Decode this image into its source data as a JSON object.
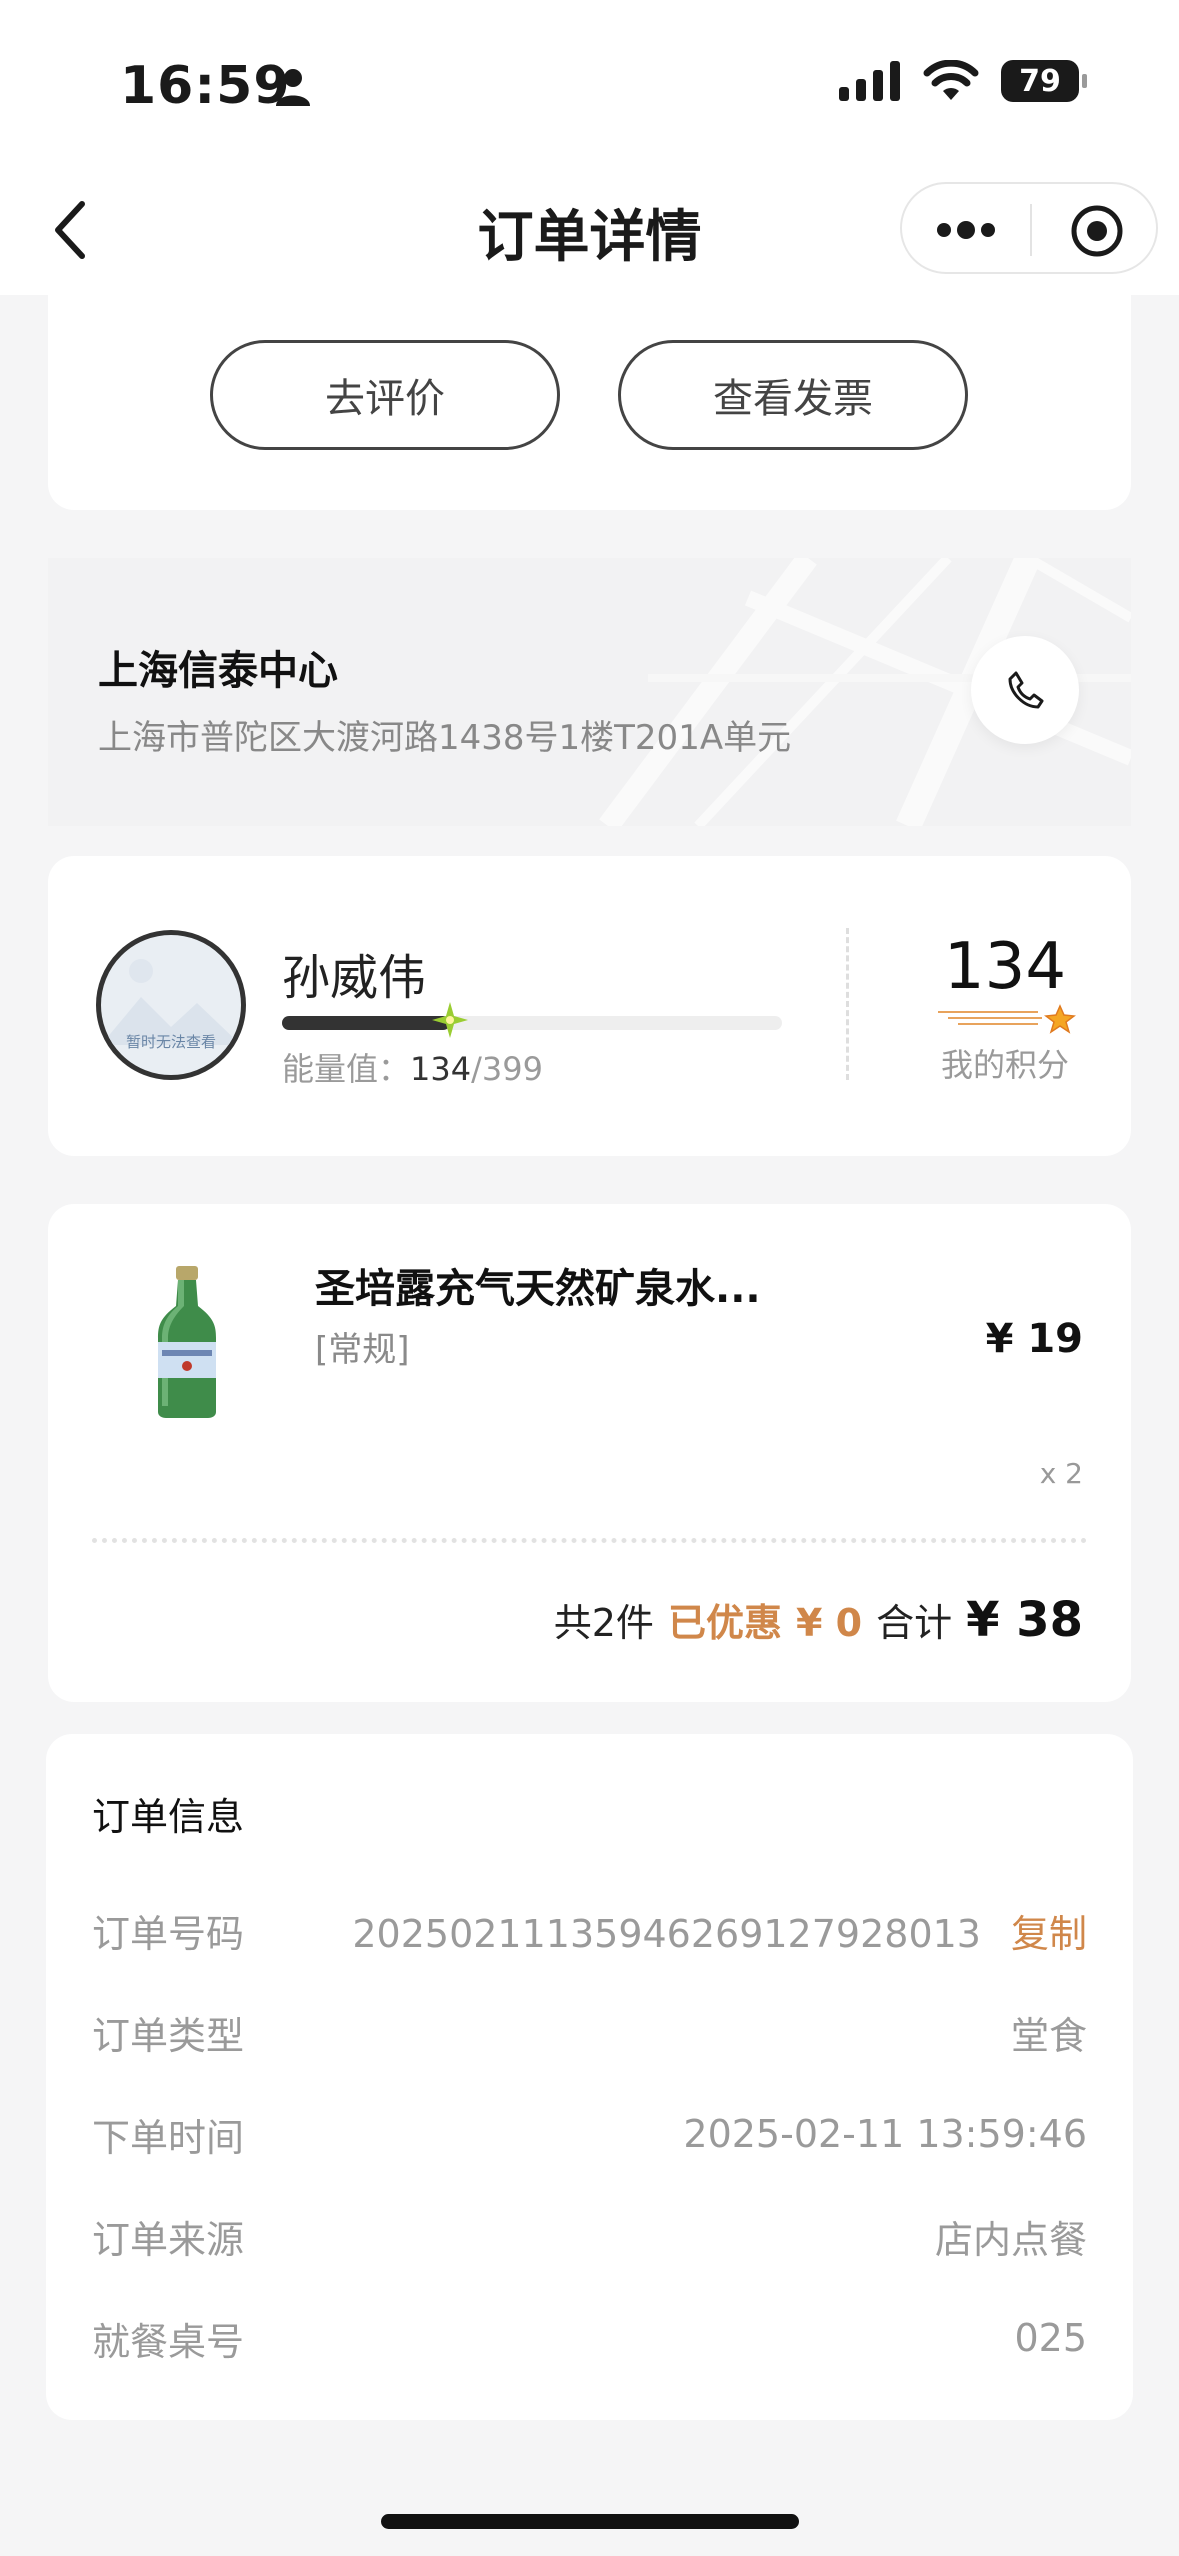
{
  "status_bar": {
    "time": "16:59",
    "battery": "79"
  },
  "nav": {
    "title": "订单详情"
  },
  "actions": {
    "review": "去评价",
    "invoice": "查看发票"
  },
  "store": {
    "name": "上海信泰中心",
    "address": "上海市普陀区大渡河路1438号1楼T201A单元"
  },
  "member": {
    "avatar_placeholder": "暂时无法查看",
    "name": "孙威伟",
    "energy_label": "能量值：",
    "energy_current": "134",
    "energy_max": "/399",
    "energy_progress": 0.336,
    "points": "134",
    "points_label": "我的积分"
  },
  "product": {
    "name": "圣培露充气天然矿泉水...",
    "spec": "[常规]",
    "price": "¥ 19",
    "qty": "x 2"
  },
  "summary": {
    "count": "共2件",
    "discount_label": "已优惠",
    "discount_value": "¥ 0",
    "total_label": "合计",
    "total_value": "¥ 38"
  },
  "order_info": {
    "title": "订单信息",
    "rows": [
      {
        "key": "订单号码",
        "value": "202502111359462691279280​13"
      },
      {
        "key": "订单类型",
        "value": "堂食"
      },
      {
        "key": "下单时间",
        "value": "2025-02-11 13:59:46"
      },
      {
        "key": "订单来源",
        "value": "店内点餐"
      },
      {
        "key": "就餐桌号",
        "value": "025"
      }
    ],
    "copy_label": "复制"
  },
  "colors": {
    "accent": "#d0874a",
    "background": "#f5f5f6"
  }
}
